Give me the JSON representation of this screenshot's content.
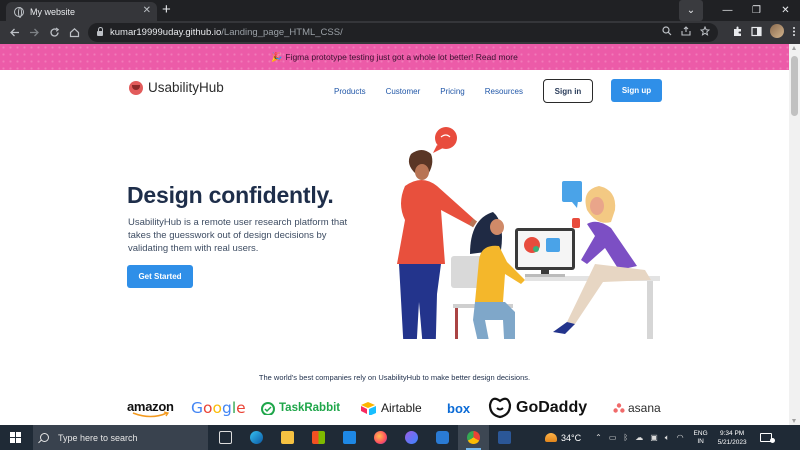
{
  "browser": {
    "tab_title": "My website",
    "tab_close": "✕",
    "new_tab": "+",
    "url_host": "kumar19999uday.github.io",
    "url_path": "/Landing_page_HTML_CSS/",
    "window_controls": {
      "dropdown": "⌄",
      "minimize": "—",
      "restore": "❐",
      "close": "✕"
    }
  },
  "page": {
    "promo_icon": "party-popper",
    "promo_text": "Figma prototype testing just got a whole lot better! Read more",
    "brand": "UsabilityHub",
    "nav": {
      "products": "Products",
      "customer": "Customer",
      "pricing": "Pricing",
      "resources": "Resources"
    },
    "sign_in": "Sign in",
    "sign_up": "Sign up",
    "hero": {
      "title": "Design confidently.",
      "text": "UsabilityHub is a remote user research platform that takes the guesswork out of design decisions by validating them with real users.",
      "cta": "Get Started"
    },
    "companies_line": "The world's best companies rely on UsabilityHub to make better design decisions.",
    "logos": {
      "amazon": "amazon",
      "google": [
        "G",
        "o",
        "o",
        "g",
        "l",
        "e"
      ],
      "taskrabbit": "TaskRabbit",
      "airtable": "Airtable",
      "box": "box",
      "godaddy": "GoDaddy",
      "asana": "asana"
    }
  },
  "taskbar": {
    "search_placeholder": "Type here to search",
    "temperature": "34°C",
    "lang_top": "ENG",
    "lang_bottom": "IN",
    "time": "9:34 PM",
    "date": "5/21/2023"
  },
  "colors": {
    "promo_bg": "#ec5ba8",
    "brand_blue": "#2f8fe8",
    "title_navy": "#1e2e4a",
    "taskbar": "#1f2a36"
  }
}
